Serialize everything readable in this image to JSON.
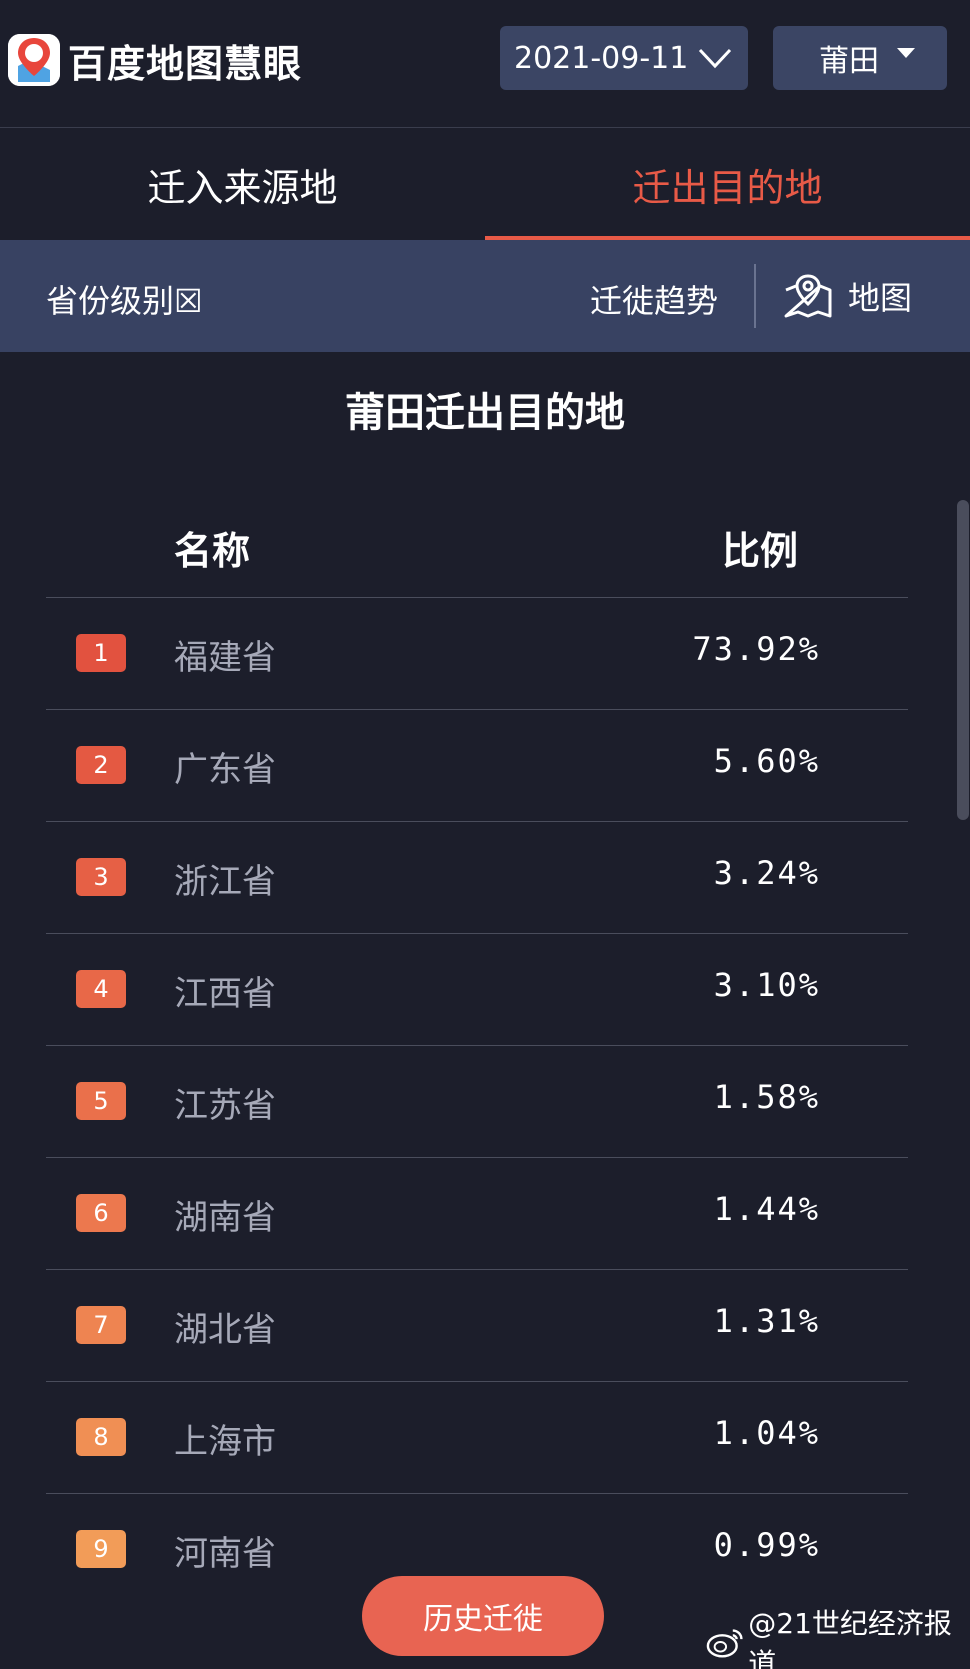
{
  "header": {
    "brand": "百度地图慧眼",
    "logo_mark": "du",
    "date": "2021-09-11",
    "city": "莆田"
  },
  "tabs": [
    {
      "label": "迁入来源地",
      "active": false
    },
    {
      "label": "迁出目的地",
      "active": true
    }
  ],
  "filter": {
    "level_label": "省份级别☒",
    "trend_label": "迁徙趋势",
    "map_label": "地图"
  },
  "section_title": "莆田迁出目的地",
  "table": {
    "col_name": "名称",
    "col_ratio": "比例",
    "rows": [
      {
        "rank": "1",
        "name": "福建省",
        "ratio": "73.92%"
      },
      {
        "rank": "2",
        "name": "广东省",
        "ratio": "5.60%"
      },
      {
        "rank": "3",
        "name": "浙江省",
        "ratio": "3.24%"
      },
      {
        "rank": "4",
        "name": "江西省",
        "ratio": "3.10%"
      },
      {
        "rank": "5",
        "name": "江苏省",
        "ratio": "1.58%"
      },
      {
        "rank": "6",
        "name": "湖南省",
        "ratio": "1.44%"
      },
      {
        "rank": "7",
        "name": "湖北省",
        "ratio": "1.31%"
      },
      {
        "rank": "8",
        "name": "上海市",
        "ratio": "1.04%"
      },
      {
        "rank": "9",
        "name": "河南省",
        "ratio": "0.99%"
      }
    ]
  },
  "history_button": "历史迁徙",
  "watermark": "@21世纪经济报道",
  "colors": {
    "accent": "#e85a47",
    "rank_badges": [
      "#e2523f",
      "#e45942",
      "#e66045",
      "#e86848",
      "#ea704b",
      "#ec784e",
      "#ee8451",
      "#f08f54",
      "#f29c58"
    ]
  }
}
